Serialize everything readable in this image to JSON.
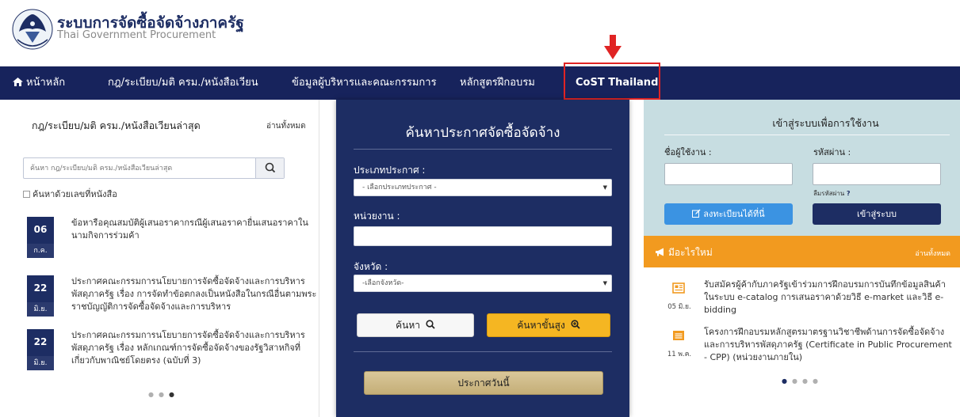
{
  "header": {
    "title_th": "ระบบการจัดซื้อจัดจ้างภาครัฐ",
    "title_en": "Thai Government Procurement",
    "logo_text": "กรมบัญชีกลาง"
  },
  "nav": {
    "items": [
      {
        "label": "หน้าหลัก"
      },
      {
        "label": "กฎ/ระเบียบ/มติ ครม./หนังสือเวียน"
      },
      {
        "label": "ข้อมูลผู้บริหารและคณะกรรมการ"
      },
      {
        "label": "หลักสูตรฝึกอบรม"
      },
      {
        "label": "CoST Thailand"
      }
    ]
  },
  "laws": {
    "title": "กฎ/ระเบียบ/มติ ครม./หนังสือเวียนล่าสุด",
    "read_all": "อ่านทั้งหมด",
    "search_placeholder": "ค้นหา กฎ/ระเบียบ/มติ ครม./หนังสือเวียนล่าสุด",
    "checkbox_label": "ค้นหาด้วยเลขที่หนังสือ",
    "items": [
      {
        "day": "06",
        "month": "ก.ค.",
        "text": "ข้อหารือคุณสมบัติผู้เสนอราคากรณีผู้เสนอราคายื่นเสนอราคาในนามกิจการร่วมค้า"
      },
      {
        "day": "22",
        "month": "มิ.ย.",
        "text": "ประกาศคณะกรรมการนโยบายการจัดซื้อจัดจ้างและการบริหารพัสดุภาครัฐ เรื่อง การจัดทำข้อตกลงเป็นหนังสือในกรณีอื่นตามพระราชบัญญัติการจัดซื้อจัดจ้างและการบริหาร"
      },
      {
        "day": "22",
        "month": "มิ.ย.",
        "text": "ประกาศคณะกรรมการนโยบายการจัดซื้อจัดจ้างและการบริหารพัสดุภาครัฐ เรื่อง หลักเกณฑ์การจัดซื้อจัดจ้างของรัฐวิสาหกิจที่เกี่ยวกับพาณิชย์โดยตรง (ฉบับที่ 3)"
      }
    ]
  },
  "search": {
    "title": "ค้นหาประกาศจัดซื้อจัดจ้าง",
    "type_label": "ประเภทประกาศ :",
    "type_selected": "- เลือกประเภทประกาศ -",
    "agency_label": "หน่วยงาน :",
    "province_label": "จังหวัด :",
    "province_selected": "-เลือกจังหวัด-",
    "search_button": "ค้นหา",
    "advanced_button": "ค้นหาขั้นสูง",
    "today_button": "ประกาศวันนี้"
  },
  "login": {
    "title": "เข้าสู่ระบบเพื่อการใช้งาน",
    "username_label": "ชื่อผู้ใช้งาน :",
    "password_label": "รหัสผ่าน :",
    "forgot_label": "ลืมรหัสผ่าน",
    "forgot_mark": "?",
    "register_button": "ลงทะเบียนได้ที่นี่",
    "login_button": "เข้าสู่ระบบ"
  },
  "whats_new": {
    "title": "มีอะไรใหม่",
    "read_all": "อ่านทั้งหมด",
    "items": [
      {
        "date": "05 มิ.ย.",
        "text": "รับสมัครผู้ค้ากับภาครัฐเข้าร่วมการฝึกอบรมการบันทึกข้อมูลสินค้าในระบบ e-catalog การเสนอราคาด้วยวิธี e-market และวิธี e-bidding"
      },
      {
        "date": "11 พ.ค.",
        "text": "โครงการฝึกอบรมหลักสูตรมาตรฐานวิชาชีพด้านการจัดซื้อจัดจ้างและการบริหารพัสดุภาครัฐ (Certificate in Public Procurement - CPP) (หน่วยงานภายใน)"
      }
    ]
  },
  "colors": {
    "navy": "#1d2d63",
    "orange": "#f29a1f",
    "gold": "#f5b622",
    "highlight_red": "#e02424",
    "login_bg": "#c7dde1"
  },
  "icons": {
    "home": "home-icon",
    "search": "search-icon",
    "zoom": "zoom-plus-icon",
    "edit": "edit-icon",
    "bullhorn": "bullhorn-icon",
    "news": "newspaper-icon",
    "arrow": "arrow-down-icon"
  }
}
